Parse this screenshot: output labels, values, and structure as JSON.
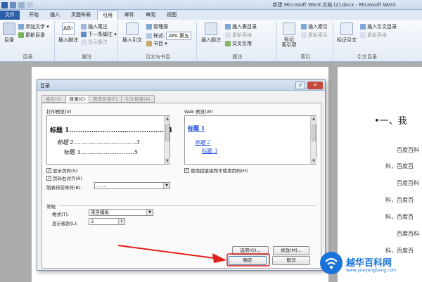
{
  "window": {
    "title": "新建 Microsoft Word 文档 (2).docx - Microsoft Word"
  },
  "ribbon_tabs": [
    "文件",
    "开始",
    "插入",
    "页面布局",
    "引用",
    "邮件",
    "审阅",
    "视图"
  ],
  "ribbon": {
    "toc": {
      "big_label": "目录",
      "add_text": "添加文字 ▾",
      "update_toc": "更新目录",
      "group_label": "目录"
    },
    "footnotes": {
      "big_label": "插入脚注",
      "insert_endnote": "插入尾注",
      "next_footnote": "下一条脚注 ▾",
      "show_notes": "显示备注",
      "group_label": "脚注"
    },
    "citations": {
      "big_label": "插入引文",
      "manage_sources": "管理源",
      "style_label": "样式:",
      "style_value": "APA 第五",
      "bibliography": "书目 ▾",
      "group_label": "引文与书目"
    },
    "captions": {
      "big_label": "插入题注",
      "insert_table_of_figures": "插入表目录",
      "update_table": "更新表格",
      "cross_reference": "交叉引用",
      "group_label": "题注"
    },
    "index": {
      "big_label": "标记\n索引项",
      "insert_index": "插入索引",
      "update_index": "更新索引",
      "group_label": "索引"
    },
    "toa": {
      "big_label": "标记引文",
      "insert_toa": "插入引文目录",
      "update_table": "更新表格",
      "group_label": "引文目录"
    }
  },
  "document": {
    "heading": "•一、我",
    "lines": [
      "百度百科",
      "科，百度百",
      "百度百科",
      "科，百度百",
      "科，百度百",
      "百度百科",
      "科，百度百"
    ]
  },
  "dialog": {
    "title": "目录",
    "help": "?",
    "close": "✕",
    "tabs": [
      "索引(X)",
      "目录(C)",
      "图表目录(F)",
      "引文目录(A)"
    ],
    "active_tab": 1,
    "print_preview_label": "打印预览(V)",
    "print_preview": [
      {
        "text": "标题 1.............................................1"
      },
      {
        "text": "标题 2...................................3"
      },
      {
        "text": "标题 3..............................5"
      }
    ],
    "web_preview_label": "Web 预览(W)",
    "web_preview": [
      "标题 1",
      "标题 2",
      "标题 3"
    ],
    "show_page_numbers": {
      "label": "显示页码(S)",
      "checked": true
    },
    "right_align_page_numbers": {
      "label": "页码右对齐(R)",
      "checked": true
    },
    "tab_leader_label": "制表符前导符(B):",
    "tab_leader_value": ".......",
    "use_hyperlinks": {
      "label": "使用超链接而不使用页码(H)",
      "checked": true
    },
    "general_label": "常规",
    "formats_label": "格式(T):",
    "formats_value": "来自模板",
    "show_levels_label": "显示级别(L):",
    "show_levels_value": "3",
    "options_button": "选项(O)...",
    "modify_button": "修改(M)...",
    "ok_button": "确定",
    "cancel_button": "取消"
  },
  "watermark": {
    "brand": "越华百科网",
    "url": "www.yueyangbang.com"
  },
  "colors": {
    "accent": "#2c5ea8",
    "annotation_arrow": "#e0201c",
    "link": "#1a47d6"
  }
}
